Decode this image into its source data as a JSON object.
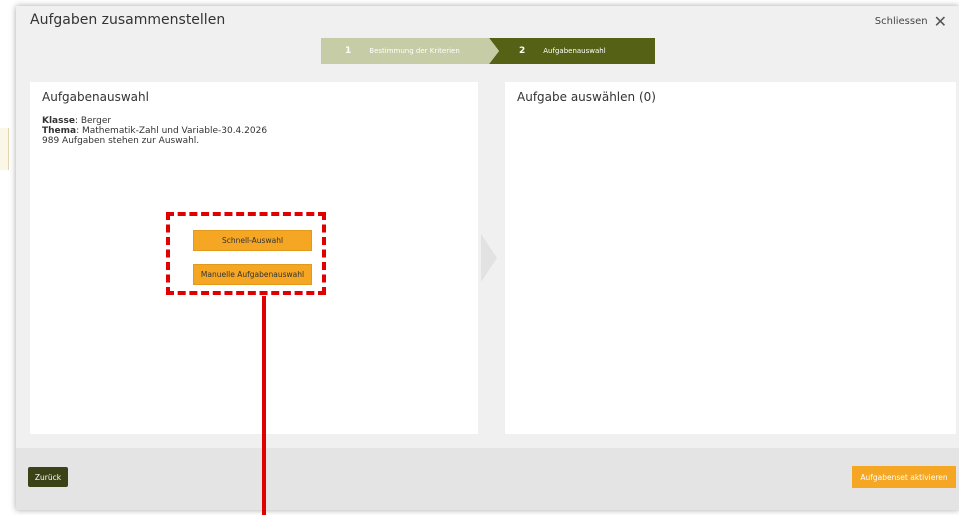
{
  "dialog": {
    "title": "Aufgaben zusammenstellen",
    "close_label": "Schliessen",
    "close_icon": "✕"
  },
  "steps": [
    {
      "number": "1",
      "label": "Bestimmung der Kriterien",
      "state": "done"
    },
    {
      "number": "2",
      "label": "Aufgabenauswahl",
      "state": "active"
    }
  ],
  "left_panel": {
    "title": "Aufgabenauswahl",
    "klasse_label": "Klasse",
    "klasse_value": ": Berger",
    "thema_label": "Thema",
    "thema_value": ": Mathematik-Zahl und Variable-30.4.2026",
    "count_text": "989 Aufgaben stehen zur Auswahl.",
    "quick_select_label": "Schnell-Auswahl",
    "manual_select_label": "Manuelle Aufgabenauswahl"
  },
  "right_panel": {
    "title": "Aufgabe auswählen (0)"
  },
  "footer": {
    "back_label": "Zurück",
    "activate_label": "Aufgabenset aktivieren"
  },
  "colors": {
    "accent_orange": "#f5a623",
    "step_active": "#556114",
    "step_done": "#c6cca5",
    "back_button": "#3b4218",
    "annotation_red": "#e10000"
  }
}
